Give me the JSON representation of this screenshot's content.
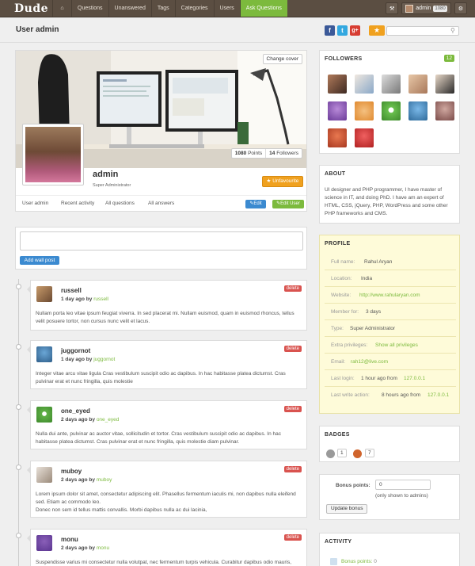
{
  "topbar": {
    "logo": "Dude",
    "nav": [
      "Questions",
      "Unanswered",
      "Tags",
      "Categories",
      "Users",
      "Ask Questions"
    ],
    "user_name": "admin",
    "user_points": "1080"
  },
  "header": {
    "title": "User admin",
    "search_placeholder": ""
  },
  "profile": {
    "change_cover": "Change cover",
    "points_value": "1080",
    "points_label": "Points",
    "followers_value": "14",
    "followers_label": "Followers",
    "name": "admin",
    "role": "Super Administrator",
    "unfavourite": "Unfavourite",
    "tabs": [
      "User admin",
      "Recent activity",
      "All questions",
      "All answers"
    ],
    "edit_label": "Edit",
    "edit_user_label": "Edit User"
  },
  "wall": {
    "button": "Add wall post"
  },
  "posts": [
    {
      "name": "russell",
      "time": "1 day ago by",
      "by": "russell",
      "delete": "delete",
      "text": "Nullam porta leo vitae ipsum feugiat viverra. In sed placerat mi. Nullam euismod, quam in euismod rhoncus, tellus velit posuere tortor, non cursus nunc velit et lacus."
    },
    {
      "name": "juggornot",
      "time": "1 day ago by",
      "by": "juggornot",
      "delete": "delete",
      "text": "Integer vitae arcu vitae ligula Cras vestibulum suscipit odio ac dapibus. In hac habitasse platea dictumst. Cras pulvinar erat et nunc fringilla, quis molestie"
    },
    {
      "name": "one_eyed",
      "time": "2 days ago by",
      "by": "one_eyed",
      "delete": "delete",
      "text": "Nulla dui ante, pulvinar ac auctor vitae, sollicitudin et tortor. Cras vestibulum suscipit odio ac dapibus. In hac habitasse platea dictumst. Cras pulvinar erat et nunc fringilla, quis molestie diam pulvinar."
    },
    {
      "name": "muboy",
      "time": "2 days ago by",
      "by": "muboy",
      "delete": "delete",
      "text": "Lorem ipsum dolor sit amet, consectetur adipiscing elit. Phasellus fermentum iaculis mi, non dapibus nulla eleifend sed. Etiam ac commodo leo.",
      "text2": "Donec non sem id tellus mattis convallis. Morbi dapibus nulla ac dui lacinia,"
    },
    {
      "name": "monu",
      "time": "2 days ago by",
      "by": "monu",
      "delete": "delete",
      "text": "Suspendisse varius mi consectetur nulla volutpat, nec fermentum turpis vehicula. Curabitur dapibus odio mauris, vitae"
    }
  ],
  "followers": {
    "title": "FOLLOWERS",
    "count": "12"
  },
  "about": {
    "title": "ABOUT",
    "text": "UI designer and PHP programmer, I have master of science in IT, and doing PhD. I have am an expert of HTML, CSS, jQuery, PHP, WordPress and some other PHP frameworks and CMS."
  },
  "profile_info": {
    "title": "PROFILE",
    "rows": [
      {
        "k": "Full name:",
        "v": "Rahul Aryan"
      },
      {
        "k": "Location:",
        "v": "India"
      },
      {
        "k": "Website:",
        "v": "http://www.rahularyan.com"
      },
      {
        "k": "Member for:",
        "v": "3 days"
      },
      {
        "k": "Type:",
        "v": "Super Administrator"
      },
      {
        "k": "Extra privileges:",
        "v": "Show all privileges"
      },
      {
        "k": "Email:",
        "v": "rah12@live.com"
      },
      {
        "k": "Last login:",
        "v": "1 hour ago from",
        "v2": "127.0.0.1"
      },
      {
        "k": "Last write action:",
        "v": "8 hours ago from",
        "v2": "127.0.0.1"
      }
    ]
  },
  "badges": {
    "title": "BADGES",
    "silver": "1",
    "bronze": "7"
  },
  "bonus": {
    "label": "Bonus points:",
    "value": "0",
    "note": "(only shown to admins)",
    "button": "Update bonus"
  },
  "activity": {
    "title": "ACTIVITY",
    "item_label": "Bonus points:",
    "item_value": "0"
  }
}
